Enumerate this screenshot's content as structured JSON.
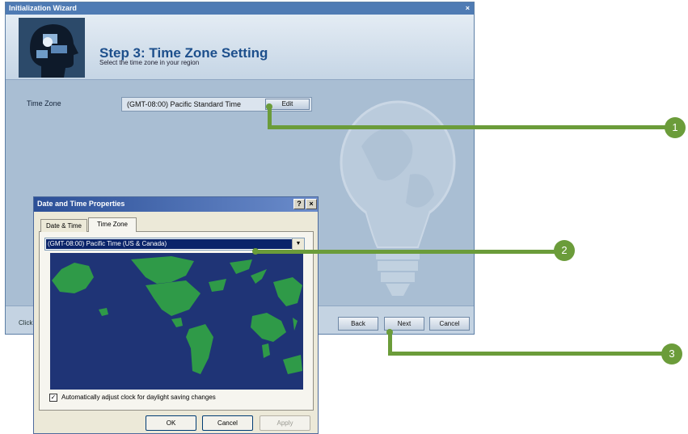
{
  "wizard": {
    "title": "Initialization Wizard",
    "close": "×",
    "step_title": "Step 3: Time Zone Setting",
    "step_subtitle": "Select the time zone in your region",
    "time_zone_label": "Time Zone",
    "time_zone_value": "(GMT-08:00) Pacific Standard Time",
    "edit_button": "Edit",
    "footer_text": "Click",
    "back_button": "Back",
    "next_button": "Next",
    "cancel_button": "Cancel"
  },
  "dialog": {
    "title": "Date and Time Properties",
    "help": "?",
    "close": "×",
    "tabs": [
      {
        "label": "Date & Time",
        "active": false
      },
      {
        "label": "Time Zone",
        "active": true
      }
    ],
    "time_zone_select": "(GMT-08:00) Pacific Time (US & Canada)",
    "dst_checked": true,
    "dst_label": "Automatically adjust clock for daylight saving changes",
    "ok_button": "OK",
    "cancel_button": "Cancel",
    "apply_button": "Apply"
  },
  "callouts": [
    "1",
    "2",
    "3"
  ],
  "colors": {
    "callout_green": "#6b9c3a",
    "wizard_background": "#a9bed3",
    "map_ocean": "#1f3476",
    "map_land": "#2f9a48",
    "selection": "#0a246a"
  },
  "icons": [
    "head-profile-icon",
    "lightbulb-globe-icon",
    "world-map-icon",
    "dropdown-arrow-icon",
    "help-icon",
    "close-icon",
    "checkbox-icon"
  ]
}
